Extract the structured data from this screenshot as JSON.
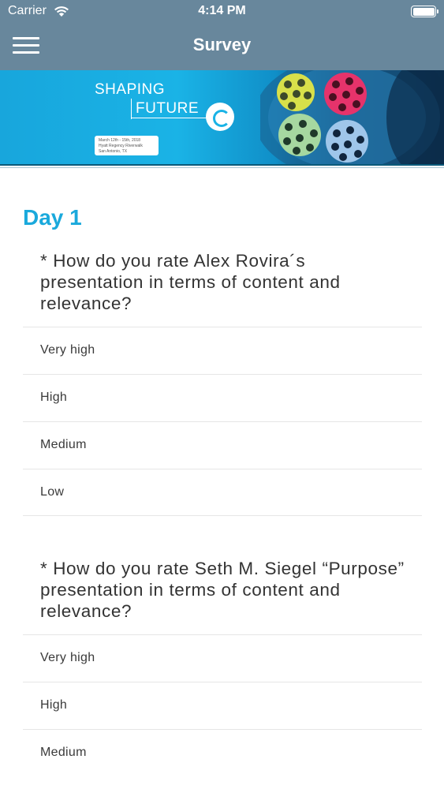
{
  "status_bar": {
    "carrier": "Carrier",
    "time": "4:14 PM"
  },
  "nav": {
    "title": "Survey",
    "menu_icon": "hamburger-menu-icon"
  },
  "banner": {
    "logo_line1": "SHAPING",
    "logo_line2": "FUTURE",
    "date_line1": "March 12th - 15th, 2018",
    "date_line2": "Hyatt Regency Riverwalk",
    "date_line3": "San Antonio, TX"
  },
  "survey": {
    "day_title": "Day 1",
    "questions": [
      {
        "text": "* How do you rate Alex Rovira´s presentation in terms of content and relevance?",
        "options": [
          "Very high",
          "High",
          "Medium",
          "Low"
        ]
      },
      {
        "text": "* How do you rate Seth M. Siegel “Purpose” presentation in terms of content and relevance?",
        "options": [
          "Very high",
          "High",
          "Medium"
        ]
      }
    ]
  },
  "colors": {
    "header": "#68879c",
    "accent": "#1aa9dc",
    "divider": "#e6e6e6"
  }
}
